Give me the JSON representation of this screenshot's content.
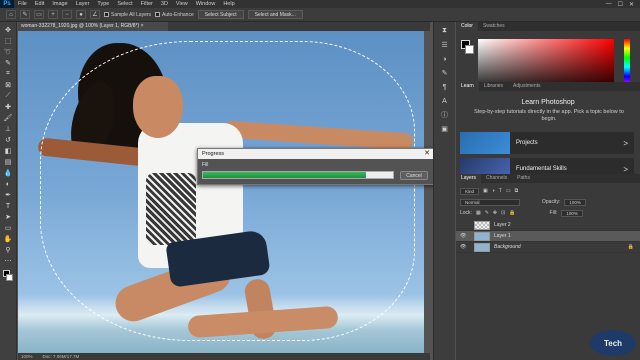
{
  "menubar": {
    "logo": "Ps",
    "items": [
      "File",
      "Edit",
      "Image",
      "Layer",
      "Type",
      "Select",
      "Filter",
      "3D",
      "View",
      "Window",
      "Help"
    ],
    "window_controls": [
      "—",
      "☐",
      "✕"
    ]
  },
  "options": {
    "sample_all_layers": "Sample All Layers",
    "auto_enhance": "Auto-Enhance",
    "select_subject": "Select Subject",
    "select_and_mask": "Select and Mask..."
  },
  "document": {
    "tab_title": "woman-332278_1920.jpg @ 100% (Layer 1, RGB/8*) ×"
  },
  "progress_dialog": {
    "title": "Progress",
    "close": "✕",
    "label": "Fill",
    "cancel": "Cancel",
    "progress": 0.86
  },
  "status": {
    "zoom": "100%",
    "doc": "Doc: 7.06M/17.7M"
  },
  "color_panel": {
    "tabs": [
      "Color",
      "Swatches"
    ],
    "foreground": "#000000",
    "background": "#ffffff"
  },
  "learn_panel": {
    "tabs": [
      "Learn",
      "Libraries",
      "Adjustments"
    ],
    "title": "Learn Photoshop",
    "description": "Step-by-step tutorials directly in the app. Pick a topic below to begin.",
    "cards": [
      {
        "label": "Projects",
        "arrow": ">"
      },
      {
        "label": "Fundamental Skills",
        "arrow": ">"
      }
    ]
  },
  "layers_panel": {
    "tabs": [
      "Layers",
      "Channels",
      "Paths"
    ],
    "kind": "Kind",
    "blend_mode": "Normal",
    "opacity_label": "Opacity:",
    "opacity_value": "100%",
    "lock_label": "Lock:",
    "fill_label": "Fill:",
    "fill_value": "100%",
    "layers": [
      {
        "name": "Layer 2",
        "selected": false
      },
      {
        "name": "Layer 1",
        "selected": true
      },
      {
        "name": "Background",
        "selected": false,
        "locked": true
      }
    ]
  },
  "watermark": "Tech"
}
